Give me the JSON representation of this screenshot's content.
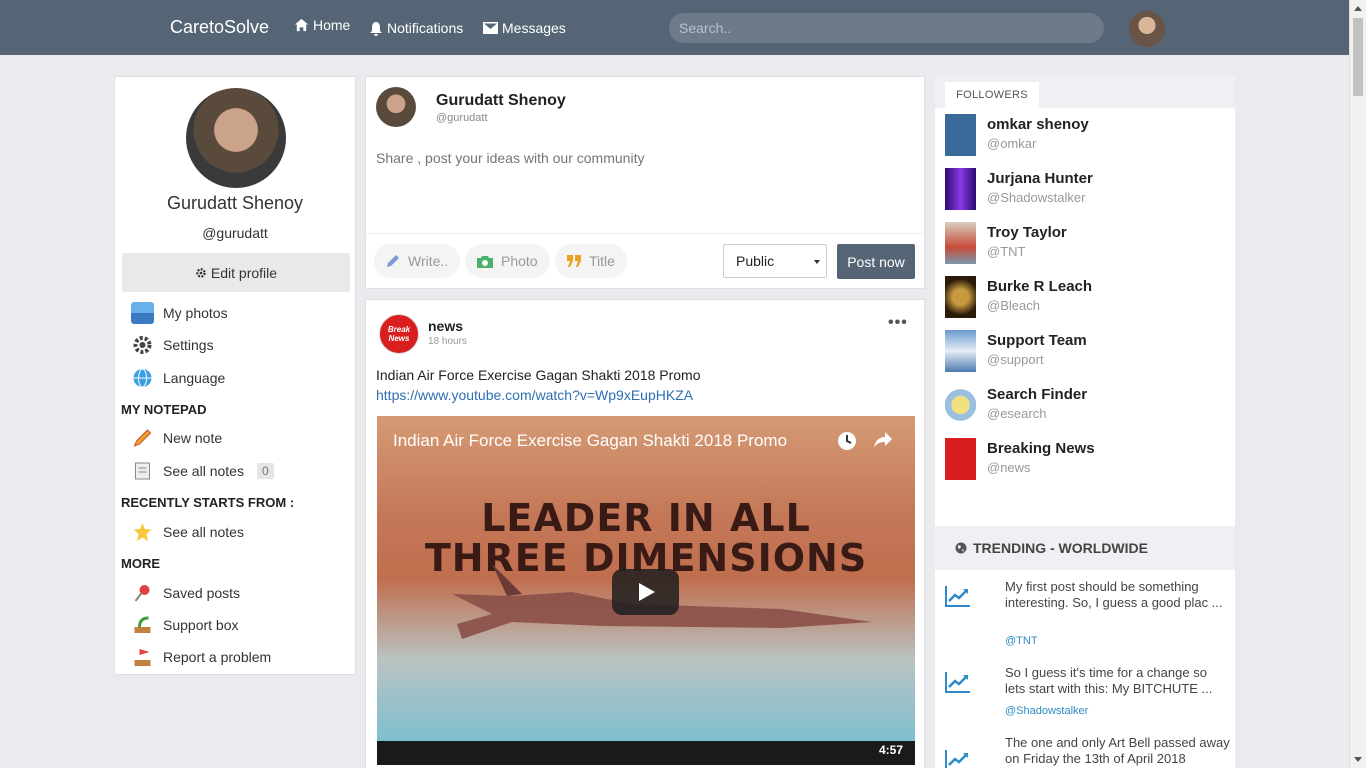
{
  "navbar": {
    "brand": "CaretoSolve",
    "home": "Home",
    "notifications": "Notifications",
    "messages": "Messages",
    "search_placeholder": "Search.."
  },
  "profile": {
    "name": "Gurudatt Shenoy",
    "handle": "@gurudatt",
    "edit_label": "Edit profile",
    "menu": [
      {
        "label": "My photos",
        "icon": "photos-icon"
      },
      {
        "label": "Settings",
        "icon": "gear-icon"
      },
      {
        "label": "Language",
        "icon": "globe-icon"
      }
    ],
    "notepad_title": "MY NOTEPAD",
    "notepad": [
      {
        "label": "New note",
        "icon": "pencil-icon"
      },
      {
        "label": "See all notes",
        "icon": "notes-icon",
        "count": "0"
      }
    ],
    "recent_title": "RECENTLY STARTS FROM :",
    "recent": [
      {
        "label": "See all notes",
        "icon": "star-note-icon"
      }
    ],
    "more_title": "MORE",
    "more": [
      {
        "label": "Saved posts",
        "icon": "pin-icon"
      },
      {
        "label": "Support box",
        "icon": "support-icon"
      },
      {
        "label": "Report a problem",
        "icon": "flag-icon"
      }
    ]
  },
  "composer": {
    "name": "Gurudatt Shenoy",
    "handle": "@gurudatt",
    "placeholder": "Share , post your ideas with our community",
    "write": "Write..",
    "photo": "Photo",
    "title": "Title",
    "visibility": "Public",
    "post_button": "Post now"
  },
  "post": {
    "logo_text": "Break News",
    "author": "news",
    "time": "18 hours",
    "text": "Indian Air Force Exercise Gagan Shakti 2018 Promo",
    "link": "https://www.youtube.com/watch?v=Wp9xEupHKZA",
    "video": {
      "title": "Indian Air Force Exercise Gagan Shakti 2018 Promo",
      "headline_1": "LEADER IN ALL",
      "headline_2": "THREE DIMENSIONS",
      "duration": "4:57"
    }
  },
  "followers": {
    "tab": "FOLLOWERS",
    "items": [
      {
        "name": "omkar shenoy",
        "handle": "@omkar",
        "color": "#3a6a9a"
      },
      {
        "name": "Jurjana Hunter",
        "handle": "@Shadowstalker",
        "color": "#6a1fd0"
      },
      {
        "name": "Troy Taylor",
        "handle": "@TNT",
        "color": "#c84a3a"
      },
      {
        "name": "Burke R Leach",
        "handle": "@Bleach",
        "color": "#6a4a1a"
      },
      {
        "name": "Support Team",
        "handle": "@support",
        "color": "#4a7ab0"
      },
      {
        "name": "Search Finder",
        "handle": "@esearch",
        "color": "#e8d060"
      },
      {
        "name": "Breaking News",
        "handle": "@news",
        "color": "#d81e1e"
      }
    ]
  },
  "trending": {
    "title": "TRENDING - WORLDWIDE",
    "items": [
      {
        "text": "My first post should be something interesting. So, I guess a good plac ...",
        "user": "@TNT"
      },
      {
        "text": "So I guess it's time for a change so lets start with this: My BITCHUTE ...",
        "user": "@Shadowstalker"
      },
      {
        "text": "The one and only Art Bell passed away on Friday the 13th of April 2018",
        "user": ""
      }
    ]
  }
}
